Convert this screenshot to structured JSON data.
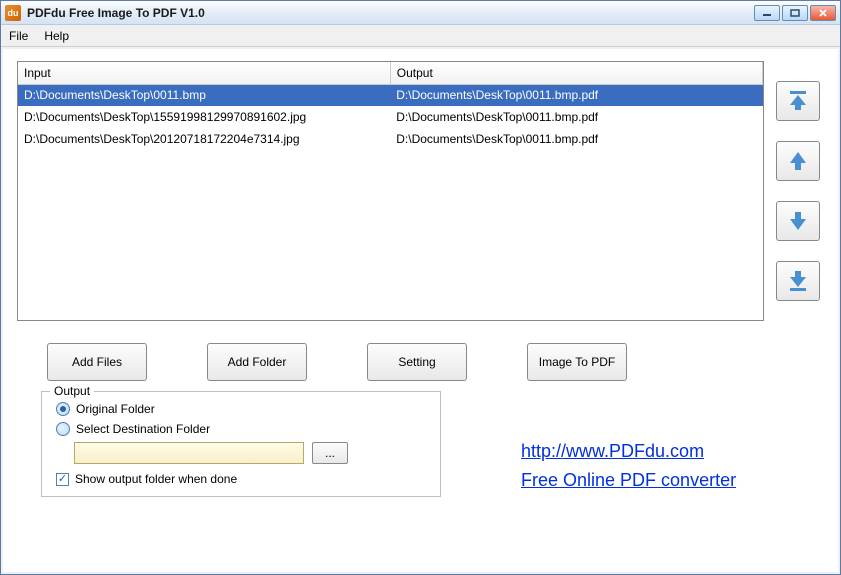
{
  "title": "PDFdu Free Image To PDF V1.0",
  "appIconText": "du",
  "menu": {
    "file": "File",
    "help": "Help"
  },
  "table": {
    "headers": {
      "input": "Input",
      "output": "Output"
    },
    "rows": [
      {
        "input": "D:\\Documents\\DeskTop\\0011.bmp",
        "output": "D:\\Documents\\DeskTop\\0011.bmp.pdf",
        "selected": true
      },
      {
        "input": "D:\\Documents\\DeskTop\\15591998129970891602.jpg",
        "output": "D:\\Documents\\DeskTop\\0011.bmp.pdf",
        "selected": false
      },
      {
        "input": "D:\\Documents\\DeskTop\\20120718172204e7314.jpg",
        "output": "D:\\Documents\\DeskTop\\0011.bmp.pdf",
        "selected": false
      }
    ]
  },
  "buttons": {
    "addFiles": "Add Files",
    "addFolder": "Add Folder",
    "setting": "Setting",
    "imageToPdf": "Image To PDF",
    "browse": "..."
  },
  "output": {
    "legend": "Output",
    "originalFolder": "Original Folder",
    "selectDest": "Select Destination Folder",
    "pathValue": "",
    "showFolder": "Show output folder when done"
  },
  "links": {
    "site": "http://www.PDFdu.com",
    "tagline": "Free Online PDF converter"
  },
  "arrowColor": "#4a90d0"
}
